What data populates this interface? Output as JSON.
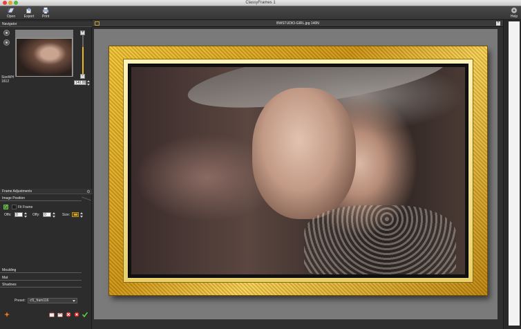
{
  "window": {
    "title": "ClassyFrames 1"
  },
  "toolbar": {
    "open_label": "Open",
    "export_label": "Export",
    "print_label": "Print",
    "help_label": "Help"
  },
  "navigator": {
    "header": "Navigator",
    "size_label_1": "SizeWH",
    "size_label_2": "1812",
    "zoom_value": "140.00",
    "zoom_level": 0.7
  },
  "frame_adjustments": {
    "header": "Frame Adjustments",
    "image_position": {
      "header": "Image Position",
      "fit_frame_label": "Fit Frame",
      "fit_frame_checked": false,
      "enabled_checked": true,
      "offx_label": "Offx:",
      "offx_value": "0",
      "offy_label": "Offy:",
      "offy_value": "0",
      "size_label": "Size:"
    },
    "sections": [
      "Moulding",
      "Mat",
      "Shadows"
    ]
  },
  "preset": {
    "label": "Preset:",
    "value": "cf1_fram116"
  },
  "document": {
    "title": "BWSTUDIO-GIRL.jpg 140N"
  },
  "colors": {
    "frame_gold": "#d9a524",
    "accent_yellow": "#e8b820",
    "canvas_bg": "#7a7a7a"
  },
  "icons": {
    "open": "open-icon",
    "export": "export-icon",
    "print": "printer-icon",
    "help": "help-icon"
  }
}
